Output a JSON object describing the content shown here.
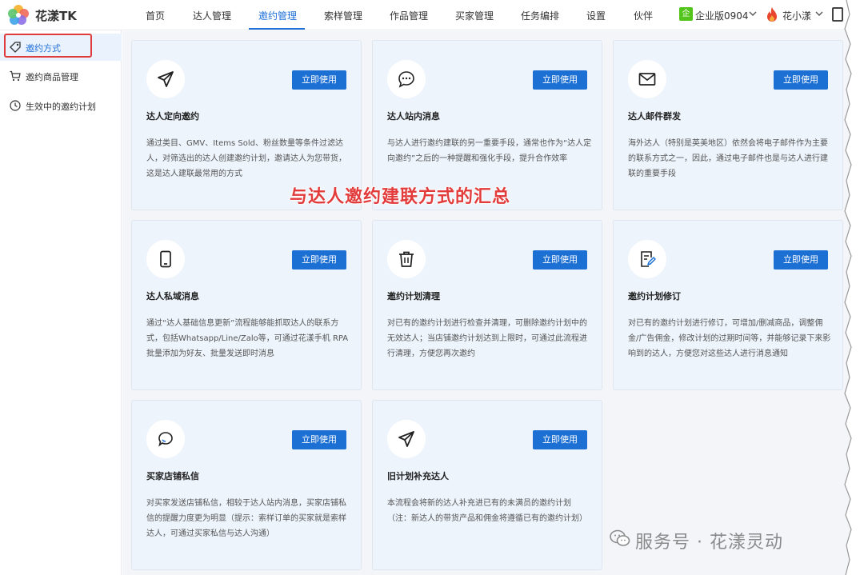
{
  "app": {
    "title": "花漾TK"
  },
  "nav": {
    "items": [
      "首页",
      "达人管理",
      "邀约管理",
      "索样管理",
      "作品管理",
      "买家管理",
      "任务编排",
      "设置",
      "伙伴"
    ],
    "active_index": 2,
    "enterprise_badge": "企",
    "enterprise_label": "企业版0904",
    "user_name": "花小漾"
  },
  "sidebar": {
    "items": [
      {
        "label": "邀约方式",
        "icon": "tag-icon",
        "active": true
      },
      {
        "label": "邀约商品管理",
        "icon": "cart-icon",
        "active": false
      },
      {
        "label": "生效中的邀约计划",
        "icon": "clock-icon",
        "active": false
      }
    ]
  },
  "cards": [
    {
      "icon": "paper-plane-icon",
      "button": "立即使用",
      "title": "达人定向邀约",
      "desc": "通过类目、GMV、Items Sold、粉丝数量等条件过滤达人，对筛选出的达人创建邀约计划，邀请达人为您带货，这是达人建联最常用的方式"
    },
    {
      "icon": "chat-bubble-icon",
      "button": "立即使用",
      "title": "达人站内消息",
      "desc": "与达人进行邀约建联的另一重要手段，通常也作为“达人定向邀约”之后的一种提醒和强化手段，提升合作效率"
    },
    {
      "icon": "envelope-icon",
      "button": "立即使用",
      "title": "达人邮件群发",
      "desc": "海外达人（特别是英美地区）依然会将电子邮件作为主要的联系方式之一，因此，通过电子邮件也是与达人进行建联的重要手段"
    },
    {
      "icon": "mobile-phone-icon",
      "button": "立即使用",
      "title": "达人私域消息",
      "desc": "通过“达人基础信息更新”流程能够能抓取达人的联系方式，包括Whatsapp/Line/Zalo等，可通过花漾手机 RPA 批量添加为好友、批量发送即时消息"
    },
    {
      "icon": "trash-icon",
      "button": "立即使用",
      "title": "邀约计划清理",
      "desc": "对已有的邀约计划进行检查并清理，可删除邀约计划中的无效达人；当店铺邀约计划达到上限时，可通过此流程进行清理，方便您再次邀约"
    },
    {
      "icon": "edit-document-icon",
      "button": "立即使用",
      "title": "邀约计划修订",
      "desc": "对已有的邀约计划进行修订，可增加/删减商品，调整佣金/广告佣金，修改计划的过期时间等，并能够记录下来影响到的达人，方便您对这些达人进行消息通知"
    },
    {
      "icon": "message-circle-icon",
      "button": "立即使用",
      "title": "买家店铺私信",
      "desc": "对买家发送店铺私信，相较于达人站内消息，买家店铺私信的提醒力度更为明显（提示：索样订单的买家就是索样达人，可通过买家私信与达人沟通）"
    },
    {
      "icon": "paper-plane-icon",
      "button": "立即使用",
      "title": "旧计划补充达人",
      "desc": "本流程会将新的达人补充进已有的未满员的邀约计划（注：新达人的带货产品和佣金将遵循已有的邀约计划）"
    }
  ],
  "overlay": {
    "caption": "与达人邀约建联方式的汇总"
  },
  "watermark": {
    "text": "服务号 · 花漾灵动"
  },
  "colors": {
    "accent": "#1e6fd9",
    "button": "#1c6fd3",
    "highlight": "#e03b3b",
    "card_bg": "#edf4fc"
  }
}
